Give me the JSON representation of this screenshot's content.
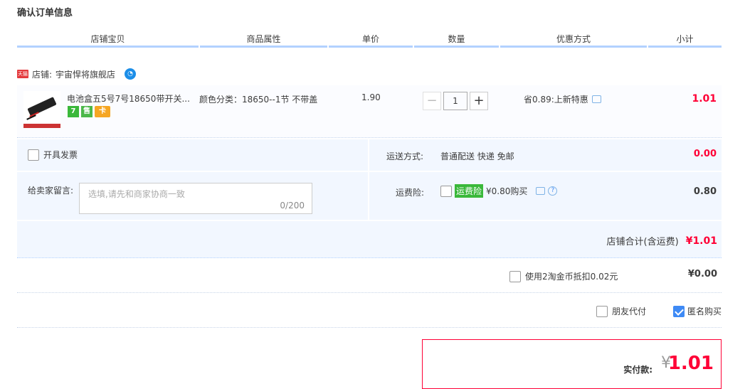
{
  "page_title": "确认订单信息",
  "columns": [
    "店铺宝贝",
    "商品属性",
    "单价",
    "数量",
    "优惠方式",
    "小计"
  ],
  "shop": {
    "badge": "天猫",
    "label": "店铺:",
    "name": "宇宙悍将旗舰店"
  },
  "item": {
    "title": "电池盒五5号7号18650带开关...",
    "service_icons": [
      "7",
      "售",
      "卡"
    ],
    "props": "颜色分类：18650--1节 不带盖",
    "price": "1.90",
    "quantity": "1",
    "minus": "−",
    "plus": "+",
    "promo": "省0.89:上新特惠",
    "subtotal": "1.01"
  },
  "invoice": {
    "label": "开具发票"
  },
  "shipping": {
    "label": "运送方式:",
    "value": "普通配送 快递 免邮",
    "fee": "0.00"
  },
  "message": {
    "label": "给卖家留言:",
    "placeholder": "选填,请先和商家协商一致",
    "counter": "0/200"
  },
  "insurance": {
    "label": "运费险:",
    "tag": "运费险",
    "price": "¥0.80购买",
    "help": "?",
    "amount": "0.80"
  },
  "shop_total": {
    "label": "店铺合计(含运费)",
    "amount": "¥1.01"
  },
  "coins": {
    "label": "使用2淘金币抵扣0.02元",
    "amount": "¥0.00"
  },
  "options": {
    "friend_pay": "朋友代付",
    "anonymous": "匿名购买"
  },
  "payment": {
    "label": "实付款:",
    "currency": "¥",
    "amount": "1.01"
  },
  "colors": {
    "accent_red": "#ff0036",
    "panel_blue": "#f2f7ff",
    "header_line": "#b2d1ff"
  }
}
